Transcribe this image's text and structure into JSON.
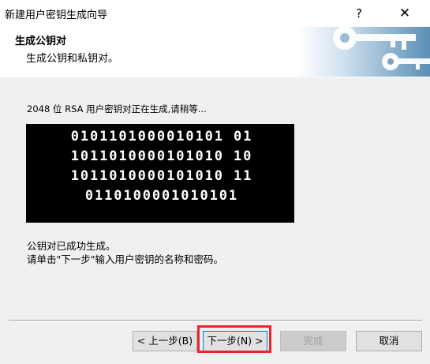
{
  "window": {
    "title": "新建用户密钥生成向导",
    "help_label": "?",
    "close_label": "✕"
  },
  "header": {
    "title": "生成公钥对",
    "subtitle": "生成公钥和私钥对。",
    "image_icon": "keys-icon"
  },
  "status_text": "2048 位 RSA 用户密钥对正在生成,请稍等...",
  "binary_lines": [
    "0101101000010101 01",
    "1011010000101010 10",
    "1011010000101010 11",
    "0110100001010101"
  ],
  "messages": {
    "line1": "公钥对已成功生成。",
    "line2": "请单击\"下一步\"输入用户密钥的名称和密码。"
  },
  "buttons": {
    "back": "< 上一步(B)",
    "next": "下一步(N) >",
    "finish": "完成",
    "cancel": "取消"
  },
  "colors": {
    "highlight": "#e8262b",
    "focus": "#0078d7",
    "header_image": "#5b8fb5"
  }
}
